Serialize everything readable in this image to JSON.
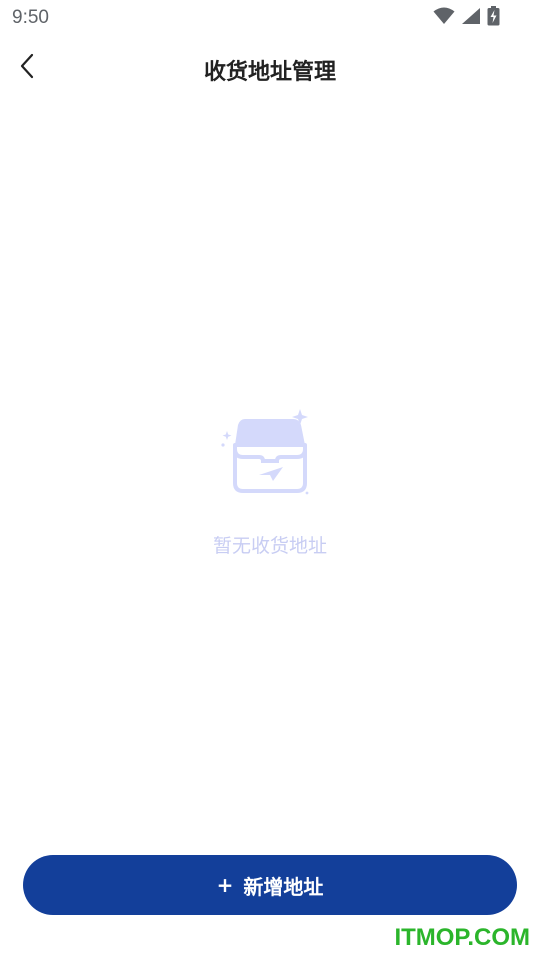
{
  "status_bar": {
    "time": "9:50",
    "icons": [
      "wifi-icon",
      "cellular-signal-icon",
      "battery-charging-icon"
    ]
  },
  "nav": {
    "back_icon": "chevron-left-icon",
    "title": "收货地址管理"
  },
  "empty_state": {
    "icon": "empty-box-icon",
    "message": "暂无收货地址"
  },
  "footer": {
    "add_button_icon": "+",
    "add_button_label": "新增地址"
  },
  "watermark": "ITMOP.COM",
  "colors": {
    "primary_button": "#133f9a",
    "empty_text": "#c8cdf3",
    "illustration": "#d4d9fb",
    "watermark": "#2bb52b"
  }
}
